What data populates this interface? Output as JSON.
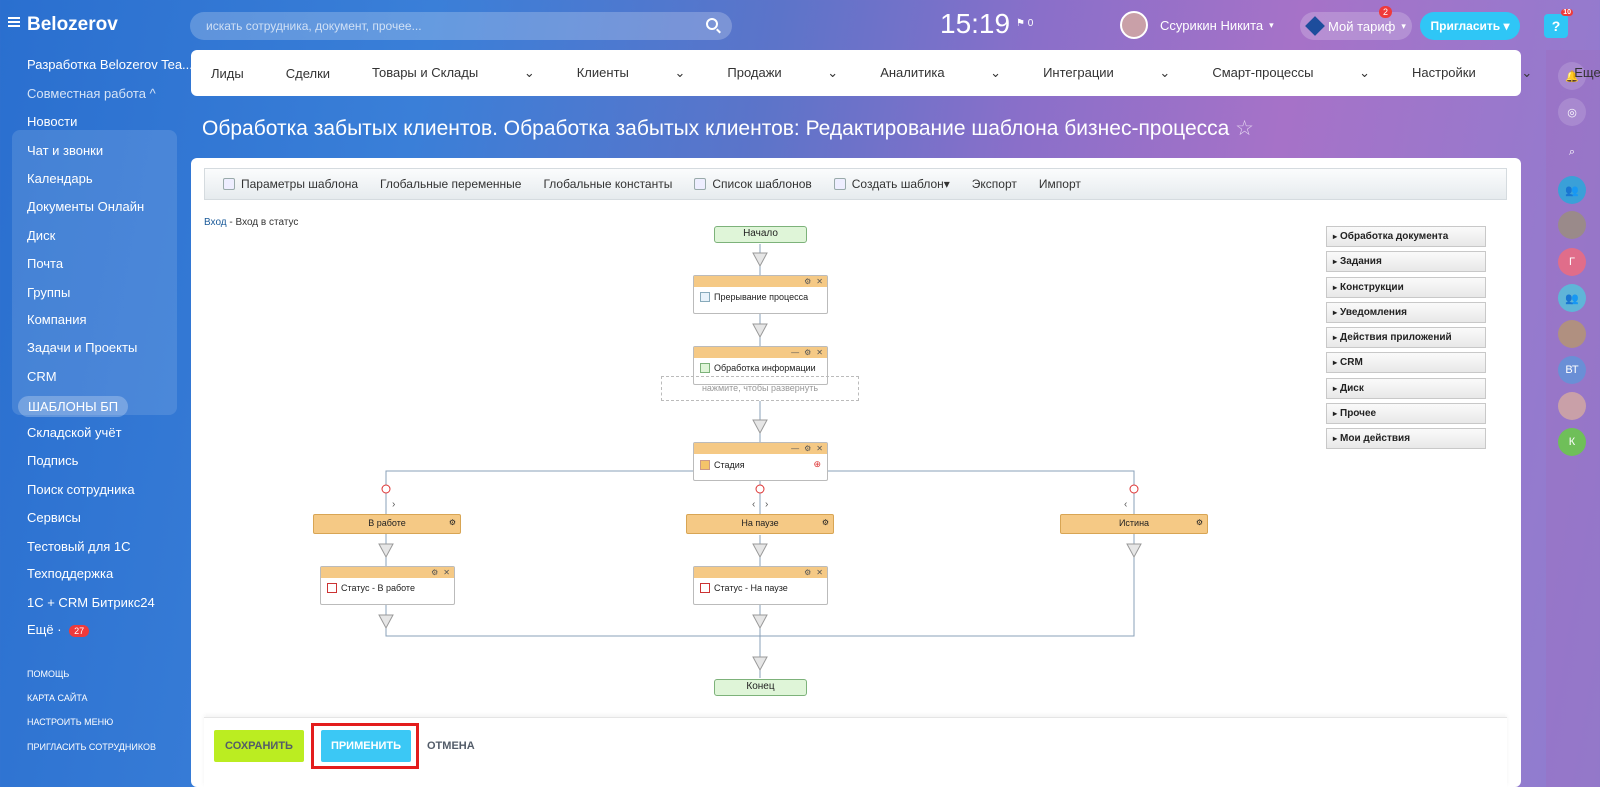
{
  "app": {
    "logo": "Belozerov",
    "clock": "15:19",
    "flag_count": "0",
    "user": "Ссурикин Никита",
    "tariff": "Мой тариф",
    "tariff_badge": "2",
    "invite": "Пригласить",
    "help": "?",
    "help_badge": "10"
  },
  "search": {
    "placeholder": "искать сотрудника, документ, прочее..."
  },
  "sidebar": {
    "items": [
      "Разработка Belozerov Tea...",
      "Совместная работа",
      "Новости",
      "Чат и звонки",
      "Календарь",
      "Документы Онлайн",
      "Диск",
      "Почта",
      "Группы",
      "Компания",
      "Задачи и Проекты",
      "CRM",
      "ШАБЛОНЫ БП",
      "Складской учёт",
      "Подпись",
      "Поиск сотрудника",
      "Сервисы",
      "Тестовый для 1С",
      "Техподдержка",
      "1С + CRM Битрикс24",
      "Ещё"
    ],
    "more_count": "27",
    "bottom": [
      "ПОМОЩЬ",
      "КАРТА САЙТА",
      "НАСТРОИТЬ МЕНЮ",
      "ПРИГЛАСИТЬ СОТРУДНИКОВ"
    ]
  },
  "nav": [
    "Лиды",
    "Сделки",
    "Товары и Склады",
    "Клиенты",
    "Продажи",
    "Аналитика",
    "Интеграции",
    "Смарт-процессы",
    "Настройки",
    "Еще"
  ],
  "page_title": "Обработка забытых клиентов. Обработка забытых клиентов: Редактирование шаблона бизнес-процесса",
  "toolbar": [
    "Параметры шаблона",
    "Глобальные переменные",
    "Глобальные константы",
    "Список шаблонов",
    "Создать шаблон",
    "Экспорт",
    "Импорт"
  ],
  "breadcrumb": {
    "link": "Вход",
    "current": "Вход в статус"
  },
  "diagram": {
    "start": "Начало",
    "end": "Конец",
    "blocks": [
      "Прерывание процесса",
      "Обработка информации",
      "Стадия",
      "Статус - В работе",
      "Статус - На паузе"
    ],
    "hint": "нажмите, чтобы развернуть",
    "branches": [
      "В работе",
      "На паузе",
      "Истина"
    ]
  },
  "activities": [
    "Обработка документа",
    "Задания",
    "Конструкции",
    "Уведомления",
    "Действия приложений",
    "CRM",
    "Диск",
    "Прочее",
    "Мои действия"
  ],
  "footer": {
    "save": "СОХРАНИТЬ",
    "apply": "ПРИМЕНИТЬ",
    "cancel": "ОТМЕНА"
  },
  "right_panel": {
    "avatar_letters": [
      "Г",
      "ВТ",
      "К"
    ]
  }
}
